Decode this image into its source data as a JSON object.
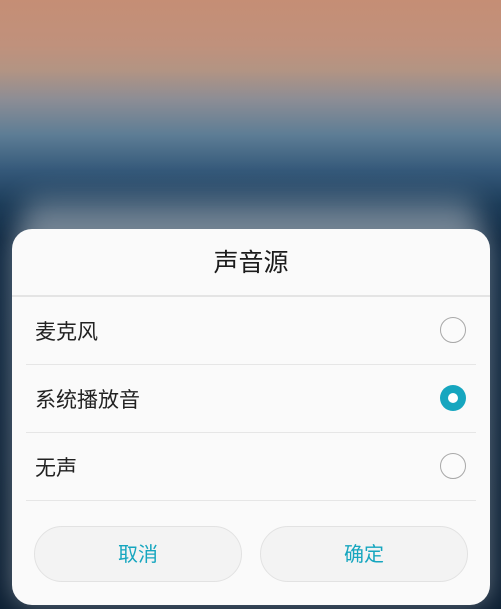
{
  "dialog": {
    "title": "声音源",
    "options": [
      {
        "label": "麦克风",
        "selected": false
      },
      {
        "label": "系统播放音",
        "selected": true
      },
      {
        "label": "无声",
        "selected": false
      }
    ],
    "cancel_label": "取消",
    "confirm_label": "确定"
  },
  "colors": {
    "accent": "#16a6bf",
    "dialog_background": "#fafafa"
  }
}
